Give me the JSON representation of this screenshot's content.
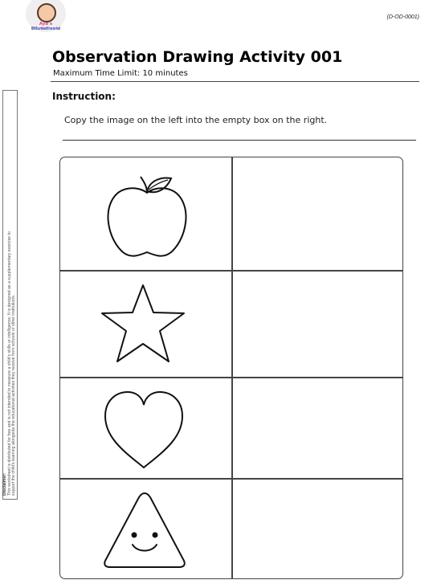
{
  "logo": {
    "line1": "Aya's Educational",
    "line2": "Worksheets"
  },
  "document_code": "(D-OD-0001)",
  "title": "Observation Drawing Activity 001",
  "subtitle": "Maximum Time Limit: 10 minutes",
  "instruction": {
    "heading": "Instruction:",
    "text": "Copy the image on the left into the empty box on the right."
  },
  "disclaimer": {
    "heading": "Disclaimer:",
    "line1": "This worksheet is distributed for free and is not intended to measure a child's skills or intelligence. It is designed as a supplementary exercise to",
    "line2": "support the child's learning alongside the educational activities they receive from schools or other institutions."
  },
  "rows": [
    {
      "shape": "apple-icon"
    },
    {
      "shape": "star-icon"
    },
    {
      "shape": "heart-icon"
    },
    {
      "shape": "smiling-triangle-icon"
    }
  ]
}
